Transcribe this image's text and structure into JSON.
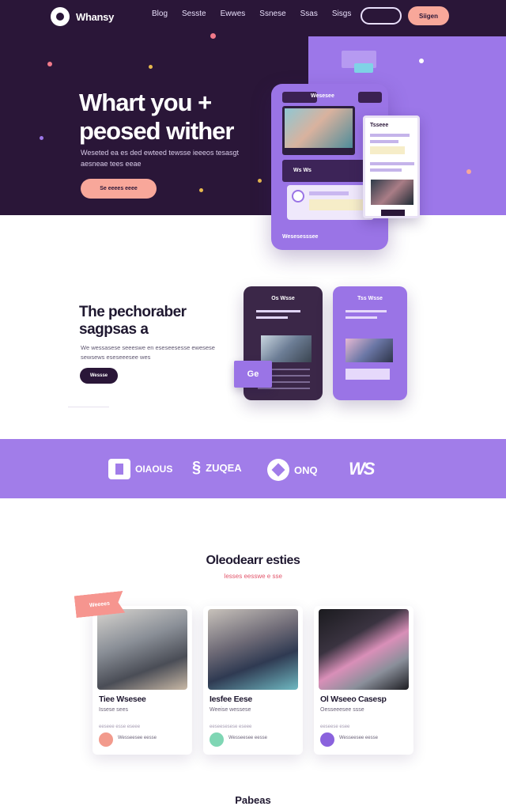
{
  "nav": {
    "brand": "Whansy",
    "links": [
      "Blog",
      "Sesste",
      "Ewwes",
      "Ssnese",
      "Ssas",
      "Sisgs"
    ],
    "cta": "Siigen"
  },
  "hero": {
    "title": "Whart you + peosed wither",
    "subtitle": "Weseted ea es ded ewteed tewsse ieeeos tesasgt aesneae tees eeae",
    "cta": "Se eeees eeee",
    "mockup": {
      "header": "Wesesee",
      "panel_label": "Ws Ws",
      "footer": "Wesesesssee",
      "phone_title": "Tsseee"
    },
    "colors": {
      "background": "#2a1638",
      "panel": "#9c77e9",
      "accent": "#f8a79a"
    }
  },
  "feature": {
    "title": "The pechoraber sagpsas a",
    "subtitle": "We wessasese seeeswe en eseseesesse ewesese sewsews eseseeesee wes",
    "button": "Wessse",
    "card_dark_title": "Os Wsse",
    "card_light_title": "Tss Wsse",
    "tag": "Ge"
  },
  "brands": [
    "OIAOUS",
    "ZUQEA",
    "ONQ",
    "WS"
  ],
  "explore": {
    "title": "Oleodearr esties",
    "subtitle": "Iesses eesswe e sse",
    "ribbon": "Weeees",
    "cards": [
      {
        "title": "Tiee Wsesee",
        "subtitle": "Issese sees",
        "meta": "eeseee esse eseee",
        "footer": "Wesseesee eesse"
      },
      {
        "title": "Iesfee Eese",
        "subtitle": "Weeise wessese",
        "meta": "eeseesesese eseee",
        "footer": "Wesseesee eesse"
      },
      {
        "title": "Ol Wseeo Casesp",
        "subtitle": "Oesseeesee ssse",
        "meta": "eeseese esee",
        "footer": "Wesseesee eesse"
      }
    ]
  },
  "bottom": {
    "title": "Pabeas"
  }
}
